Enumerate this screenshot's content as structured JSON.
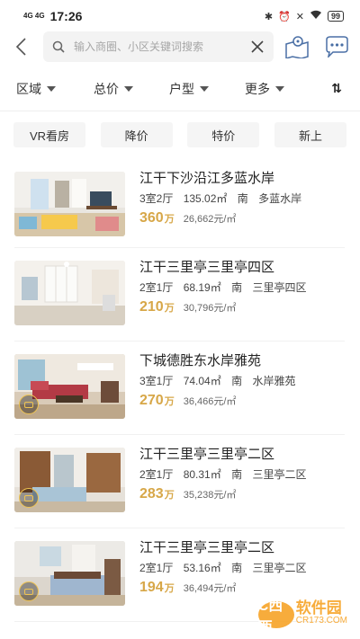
{
  "status_bar": {
    "network": "4G 4G",
    "time": "17:26",
    "battery": "99"
  },
  "search": {
    "placeholder": "输入商圈、小区关键词搜索"
  },
  "filters": [
    {
      "label": "区域"
    },
    {
      "label": "总价"
    },
    {
      "label": "户型"
    },
    {
      "label": "更多"
    }
  ],
  "sort_label": "⇅",
  "chips": [
    "VR看房",
    "降价",
    "特价",
    "新上"
  ],
  "listings": [
    {
      "title": "江干下沙沿江多蓝水岸",
      "layout": "3室2厅",
      "area": "135.02㎡",
      "orientation": "南",
      "community": "多蓝水岸",
      "price": "360",
      "price_unit": "万",
      "unit_price": "26,662元/㎡",
      "vr": false
    },
    {
      "title": "江干三里亭三里亭四区",
      "layout": "2室1厅",
      "area": "68.19㎡",
      "orientation": "南",
      "community": "三里亭四区",
      "price": "210",
      "price_unit": "万",
      "unit_price": "30,796元/㎡",
      "vr": false
    },
    {
      "title": "下城德胜东水岸雅苑",
      "layout": "3室1厅",
      "area": "74.04㎡",
      "orientation": "南",
      "community": "水岸雅苑",
      "price": "270",
      "price_unit": "万",
      "unit_price": "36,466元/㎡",
      "vr": true
    },
    {
      "title": "江干三里亭三里亭二区",
      "layout": "2室1厅",
      "area": "80.31㎡",
      "orientation": "南",
      "community": "三里亭二区",
      "price": "283",
      "price_unit": "万",
      "unit_price": "35,238元/㎡",
      "vr": true
    },
    {
      "title": "江干三里亭三里亭二区",
      "layout": "2室1厅",
      "area": "53.16㎡",
      "orientation": "南",
      "community": "三里亭二区",
      "price": "194",
      "price_unit": "万",
      "unit_price": "36,494元/㎡",
      "vr": true
    }
  ],
  "watermark": {
    "logo": "C西西",
    "main": "软件园",
    "sub": "CR173.COM"
  },
  "colors": {
    "accent_gold": "#d7a748",
    "watermark": "#f7a427"
  }
}
